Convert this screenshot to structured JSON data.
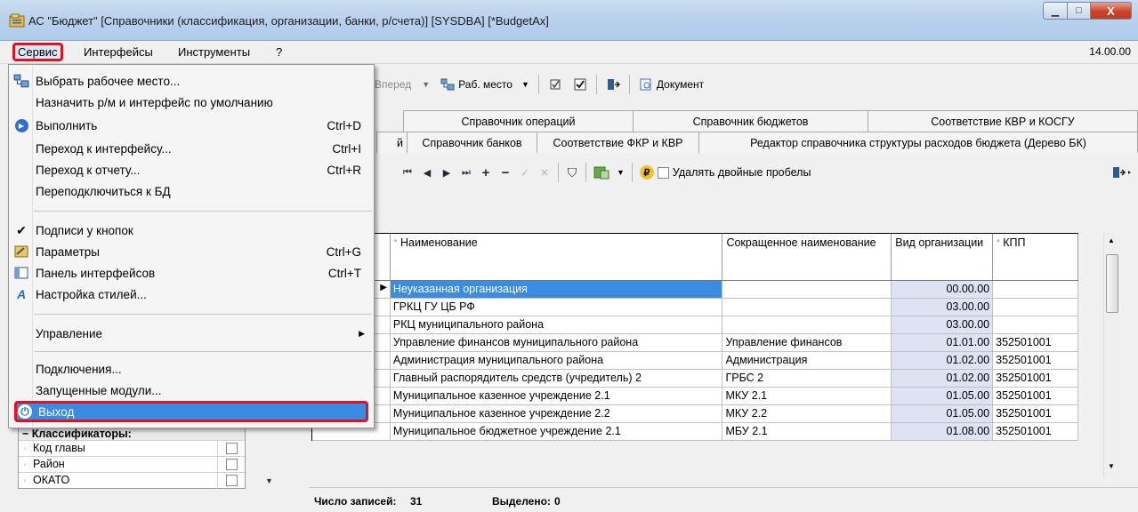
{
  "window": {
    "title": "АС \"Бюджет\" [Справочники (классификация, организации, банки, р/счета)] [SYSDBA] [*BudgetAx]",
    "minimize_glyph": "▁",
    "maximize_glyph": "□",
    "close_glyph": "X"
  },
  "menubar": {
    "items": [
      "Сервис",
      "Интерфейсы",
      "Инструменты",
      "?"
    ],
    "version": "14.00.00"
  },
  "toolbar1": {
    "forward": "Вперед",
    "workplace": "Раб. место",
    "document": "Документ"
  },
  "tabs": {
    "row1": [
      "Справочник операций",
      "Справочник бюджетов",
      "Соответствие КВР и КОСГУ"
    ],
    "row2": [
      "й",
      "Справочник банков",
      "Соответствие ФКР и КВР",
      "Редактор справочника структуры расходов бюджета (Дерево БК)"
    ]
  },
  "toolbar2": {
    "remove_double_spaces": "Удалять двойные пробелы"
  },
  "grid": {
    "headers": {
      "name": "Наименование",
      "short_name": "Сокращенное наименование",
      "org_type": "Вид организации",
      "kpp": "КПП"
    },
    "rows": [
      {
        "name": "Неуказанная организация",
        "short": "",
        "vid": "00.00.00",
        "kpp": ""
      },
      {
        "name": "ГРКЦ ГУ ЦБ РФ",
        "short": "",
        "vid": "03.00.00",
        "kpp": ""
      },
      {
        "name": "РКЦ муниципального района",
        "short": "",
        "vid": "03.00.00",
        "kpp": ""
      },
      {
        "name": "Управление финансов муниципального района",
        "short": "Управление финансов",
        "vid": "01.01.00",
        "kpp": "352501001"
      },
      {
        "name": "Администрация муниципального района",
        "short": "Администрация",
        "vid": "01.02.00",
        "kpp": "352501001"
      },
      {
        "name": "Главный распорядитель средств (учредитель) 2",
        "short": "ГРБС 2",
        "vid": "01.02.00",
        "kpp": "352501001"
      },
      {
        "name": "Муниципальное казенное учреждение 2.1",
        "short": "МКУ 2.1",
        "vid": "01.05.00",
        "kpp": "352501001"
      },
      {
        "name": "Муниципальное казенное учреждение 2.2",
        "short": "МКУ 2.2",
        "vid": "01.05.00",
        "kpp": "352501001"
      },
      {
        "name": "Муниципальное бюджетное учреждение 2.1",
        "short": "МБУ 2.1",
        "vid": "01.08.00",
        "kpp": "352501001"
      }
    ]
  },
  "status": {
    "records_label": "Число записей:",
    "records_value": "31",
    "selected_label": "Выделено:",
    "selected_value": "0"
  },
  "classifiers": {
    "title": "Классификаторы:",
    "items": [
      "Код главы",
      "Район",
      "ОКАТО"
    ]
  },
  "service_menu": {
    "items": [
      {
        "label": "Выбрать рабочее место...",
        "shortcut": "",
        "icon": "workplace-icon"
      },
      {
        "label": "Назначить р/м и интерфейс по умолчанию",
        "shortcut": "",
        "icon": ""
      },
      {
        "label": "Выполнить",
        "shortcut": "Ctrl+D",
        "icon": "run-icon"
      },
      {
        "label": "Переход к интерфейсу...",
        "shortcut": "Ctrl+I",
        "icon": ""
      },
      {
        "label": "Переход к отчету...",
        "shortcut": "Ctrl+R",
        "icon": ""
      },
      {
        "label": "Переподключиться к БД",
        "shortcut": "",
        "icon": ""
      },
      {
        "label": "Подписи у кнопок",
        "shortcut": "",
        "icon": "checkmark-icon"
      },
      {
        "label": "Параметры",
        "shortcut": "Ctrl+G",
        "icon": "parameters-icon"
      },
      {
        "label": "Панель интерфейсов",
        "shortcut": "Ctrl+T",
        "icon": "panel-icon"
      },
      {
        "label": "Настройка стилей...",
        "shortcut": "",
        "icon": "styles-icon"
      },
      {
        "label": "Управление",
        "shortcut": "",
        "icon": ""
      },
      {
        "label": "Подключения...",
        "shortcut": "",
        "icon": ""
      },
      {
        "label": "Запущенные модули...",
        "shortcut": "",
        "icon": ""
      },
      {
        "label": "Выход",
        "shortcut": "",
        "icon": "power-icon"
      }
    ]
  },
  "colors": {
    "highlight": "#3b8be0",
    "annotation_red": "#e0121f"
  }
}
